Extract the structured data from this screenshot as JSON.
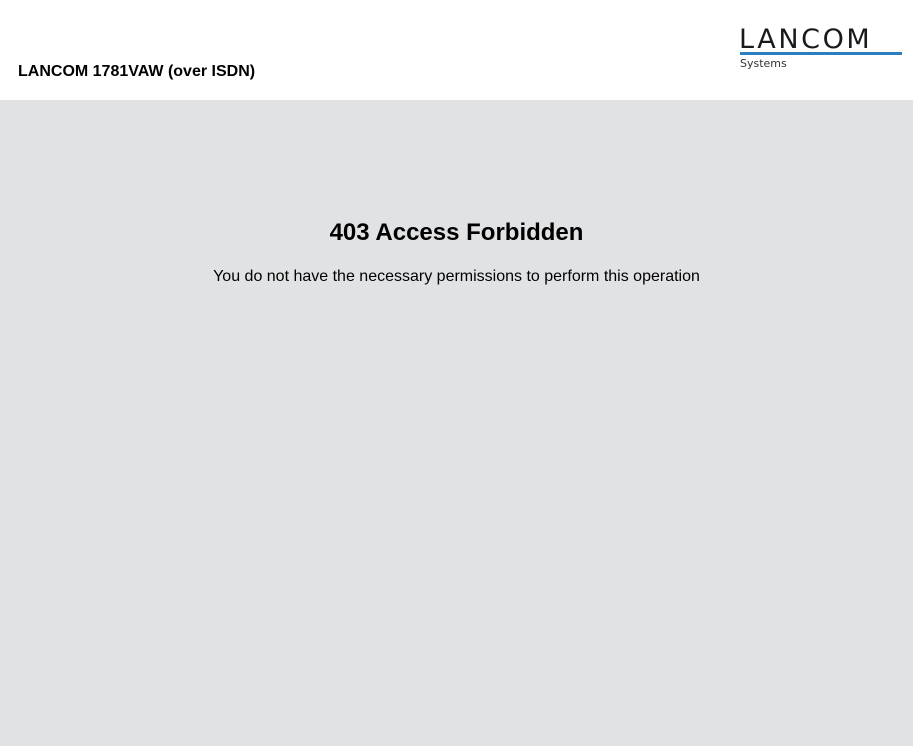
{
  "header": {
    "device_title": "LANCOM 1781VAW (over ISDN)",
    "logo": {
      "word": "LANCOM",
      "sub": "Systems",
      "accent_color": "#2a7fc1"
    }
  },
  "main": {
    "error_title": "403 Access Forbidden",
    "error_message": "You do not have the necessary permissions to perform this operation"
  },
  "colors": {
    "header_background": "#ffffff",
    "content_background": "#e1e2e4"
  }
}
